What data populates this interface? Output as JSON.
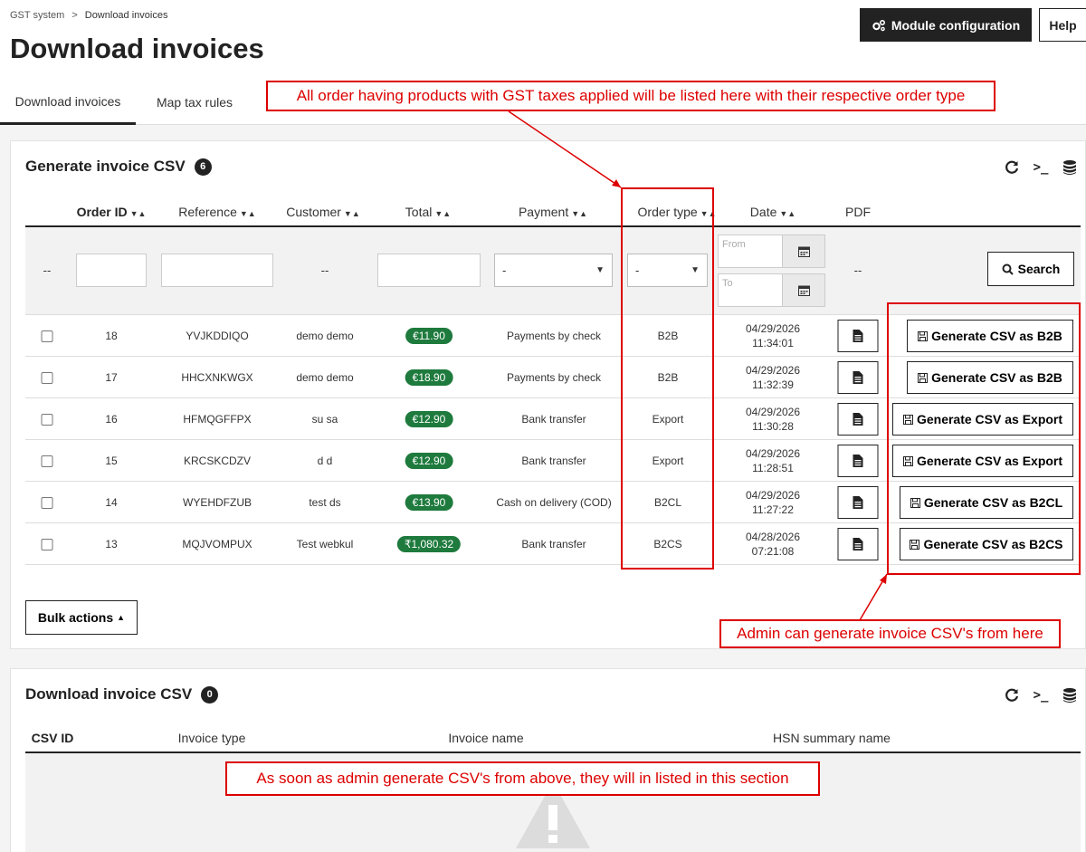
{
  "breadcrumb": {
    "root": "GST system",
    "separator": ">",
    "current": "Download invoices"
  },
  "page_title": "Download invoices",
  "header_buttons": {
    "module_config": "Module configuration",
    "help": "Help"
  },
  "tabs": [
    {
      "label": "Download invoices",
      "active": true
    },
    {
      "label": "Map tax rules",
      "active": false
    }
  ],
  "generate_panel": {
    "title": "Generate invoice CSV",
    "count": "6",
    "columns": [
      "Order ID",
      "Reference",
      "Customer",
      "Total",
      "Payment",
      "Order type",
      "Date",
      "PDF"
    ],
    "filters": {
      "empty": "--",
      "select_default": "-",
      "date_from_placeholder": "From",
      "date_to_placeholder": "To",
      "search_label": "Search"
    },
    "rows": [
      {
        "id": "18",
        "reference": "YVJKDDIQO",
        "customer": "demo demo",
        "total": "€11.90",
        "payment": "Payments by check",
        "order_type": "B2B",
        "date": "04/29/2026",
        "time": "11:34:01",
        "action": "Generate CSV as B2B"
      },
      {
        "id": "17",
        "reference": "HHCXNKWGX",
        "customer": "demo demo",
        "total": "€18.90",
        "payment": "Payments by check",
        "order_type": "B2B",
        "date": "04/29/2026",
        "time": "11:32:39",
        "action": "Generate CSV as B2B"
      },
      {
        "id": "16",
        "reference": "HFMQGFFPX",
        "customer": "su sa",
        "total": "€12.90",
        "payment": "Bank transfer",
        "order_type": "Export",
        "date": "04/29/2026",
        "time": "11:30:28",
        "action": "Generate CSV as Export"
      },
      {
        "id": "15",
        "reference": "KRCSKCDZV",
        "customer": "d d",
        "total": "€12.90",
        "payment": "Bank transfer",
        "order_type": "Export",
        "date": "04/29/2026",
        "time": "11:28:51",
        "action": "Generate CSV as Export"
      },
      {
        "id": "14",
        "reference": "WYEHDFZUB",
        "customer": "test ds",
        "total": "€13.90",
        "payment": "Cash on delivery (COD)",
        "order_type": "B2CL",
        "date": "04/29/2026",
        "time": "11:27:22",
        "action": "Generate CSV as B2CL"
      },
      {
        "id": "13",
        "reference": "MQJVOMPUX",
        "customer": "Test webkul",
        "total": "₹1,080.32",
        "payment": "Bank transfer",
        "order_type": "B2CS",
        "date": "04/28/2026",
        "time": "07:21:08",
        "action": "Generate CSV as B2CS"
      }
    ],
    "bulk_actions": "Bulk actions"
  },
  "download_panel": {
    "title": "Download invoice CSV",
    "count": "0",
    "columns": [
      "CSV ID",
      "Invoice type",
      "Invoice name",
      "HSN summary name"
    ]
  },
  "annotations": {
    "order_type_note": "All order having products with GST taxes applied will be listed here with their respective order type",
    "generate_note": "Admin can generate invoice CSV's from here",
    "download_note": "As soon as admin generate CSV's from above, they will in listed in this section"
  },
  "colors": {
    "total_pill": "#1e7a3d",
    "annotation": "#dd0000",
    "dark_button": "#222222"
  }
}
